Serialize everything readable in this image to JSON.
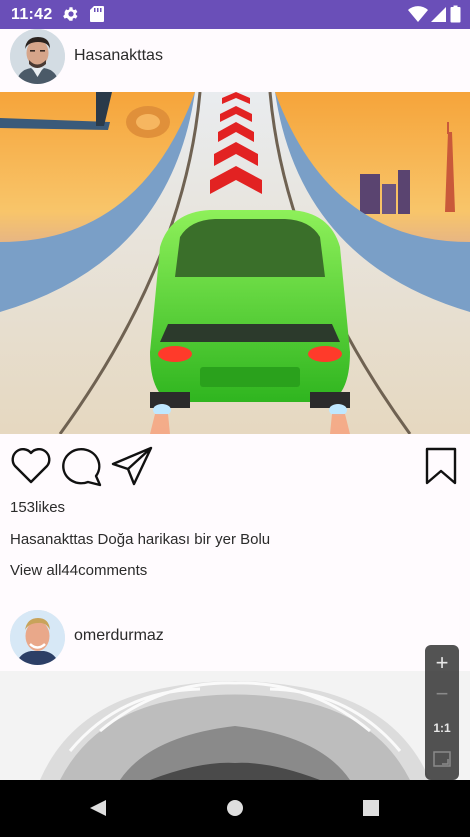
{
  "status_bar": {
    "time": "11:42",
    "icons": [
      "settings-icon",
      "sd-card-icon",
      "wifi-icon",
      "cellular-signal-icon",
      "battery-icon"
    ],
    "background_color": "#6a4fb8"
  },
  "posts": [
    {
      "username": "Hasanakttas",
      "image": "racing-car-game-image",
      "likes": "153likes",
      "caption": "Hasanakttas Doğa harikası bir yer Bolu",
      "comments_link": "View all44comments",
      "actions": [
        "like-icon",
        "comment-icon",
        "share-icon",
        "bookmark-icon"
      ]
    },
    {
      "username": "omerdurmaz",
      "image": "white-hair-portrait-image"
    }
  ],
  "zoom_controls": {
    "zoom_in": "+",
    "zoom_out": "−",
    "actual_size": "1:1",
    "icons": [
      "zoom-in-icon",
      "zoom-out-icon",
      "fit-screen-icon"
    ]
  },
  "nav_bar": {
    "icons": [
      "back-icon",
      "home-icon",
      "recents-icon"
    ]
  }
}
